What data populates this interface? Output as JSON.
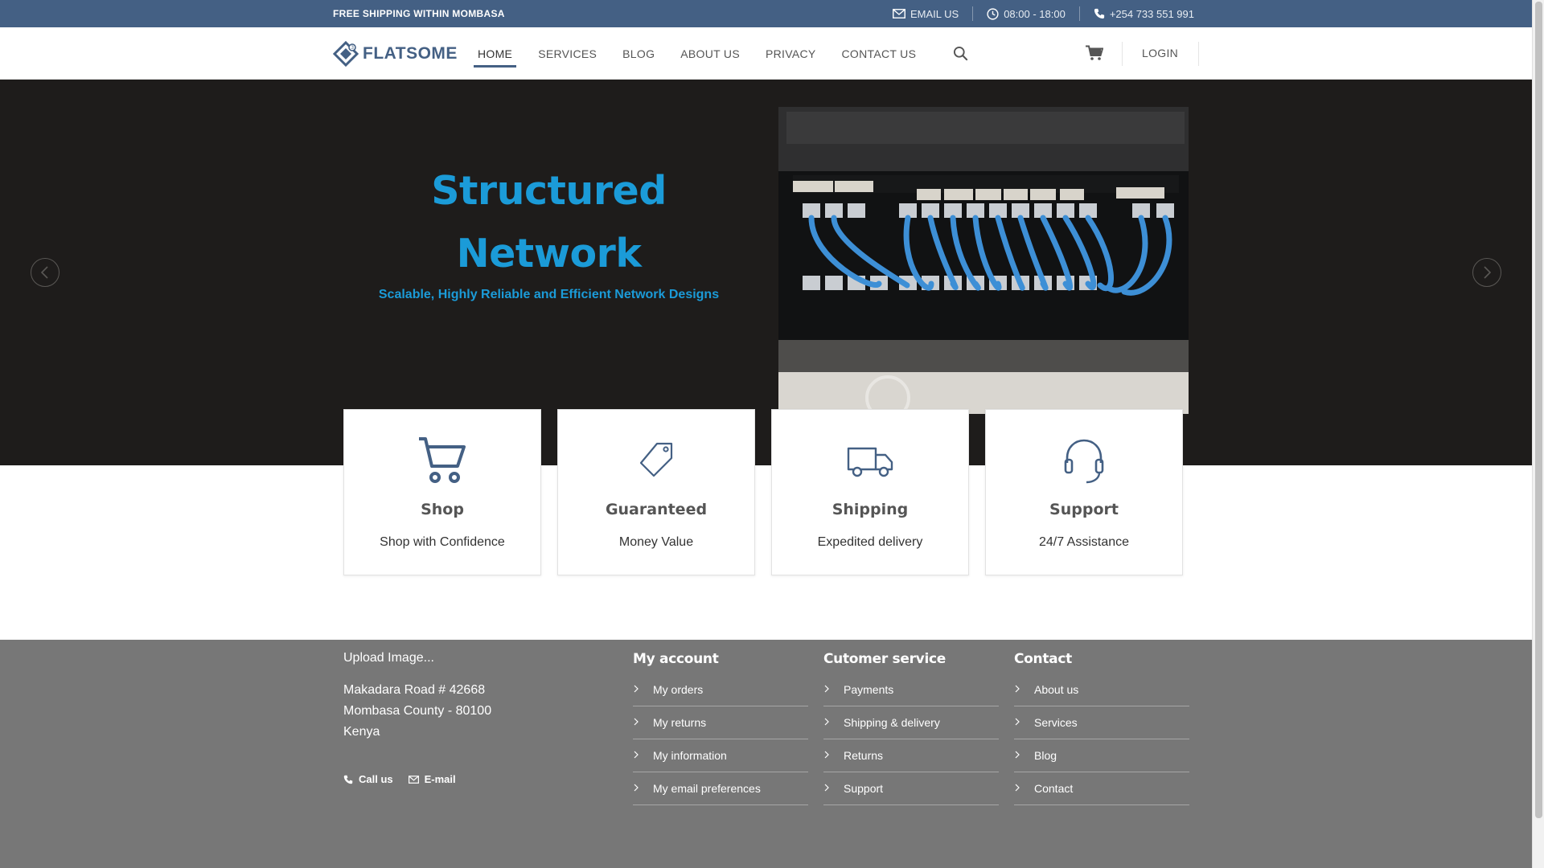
{
  "topbar": {
    "promo": "FREE SHIPPING WITHIN MOMBASA",
    "email_label": "EMAIL US",
    "hours": "08:00 - 18:00",
    "phone": "+254 733 551 991"
  },
  "header": {
    "logo_text": "FLATSOME",
    "nav": [
      "HOME",
      "SERVICES",
      "BLOG",
      "ABOUT US",
      "PRIVACY",
      "CONTACT US"
    ],
    "active_nav": "HOME",
    "login": "LOGIN"
  },
  "hero": {
    "title_line1": "Structured",
    "title_line2": "Network",
    "subtitle": "Scalable, Highly Reliable and Efficient Network Designs"
  },
  "features": [
    {
      "icon": "cart-icon",
      "title": "Shop",
      "desc": "Shop with Confidence"
    },
    {
      "icon": "tag-icon",
      "title": "Guaranteed",
      "desc": "Money Value"
    },
    {
      "icon": "truck-icon",
      "title": "Shipping",
      "desc": "Expedited delivery"
    },
    {
      "icon": "headset-icon",
      "title": "Support",
      "desc": "24/7 Assistance"
    }
  ],
  "footer": {
    "upload": "Upload Image...",
    "address_line1": "Makadara Road # 42668",
    "address_line2": "Mombasa County - 80100",
    "address_line3": "Kenya",
    "call_us": "Call us",
    "email": "E-mail",
    "columns": [
      {
        "heading": "My account",
        "items": [
          "My orders",
          "My returns",
          "My information",
          "My email preferences"
        ]
      },
      {
        "heading": "Cutomer service",
        "items": [
          "Payments",
          "Shipping & delivery",
          "Returns",
          "Support"
        ]
      },
      {
        "heading": "Contact",
        "items": [
          "About us",
          "Services",
          "Blog",
          "Contact"
        ]
      }
    ]
  },
  "colors": {
    "brand": "#446084",
    "accent": "#1b9bd8",
    "hero_bg": "#1e1c1b",
    "footer_bg": "#777777"
  }
}
